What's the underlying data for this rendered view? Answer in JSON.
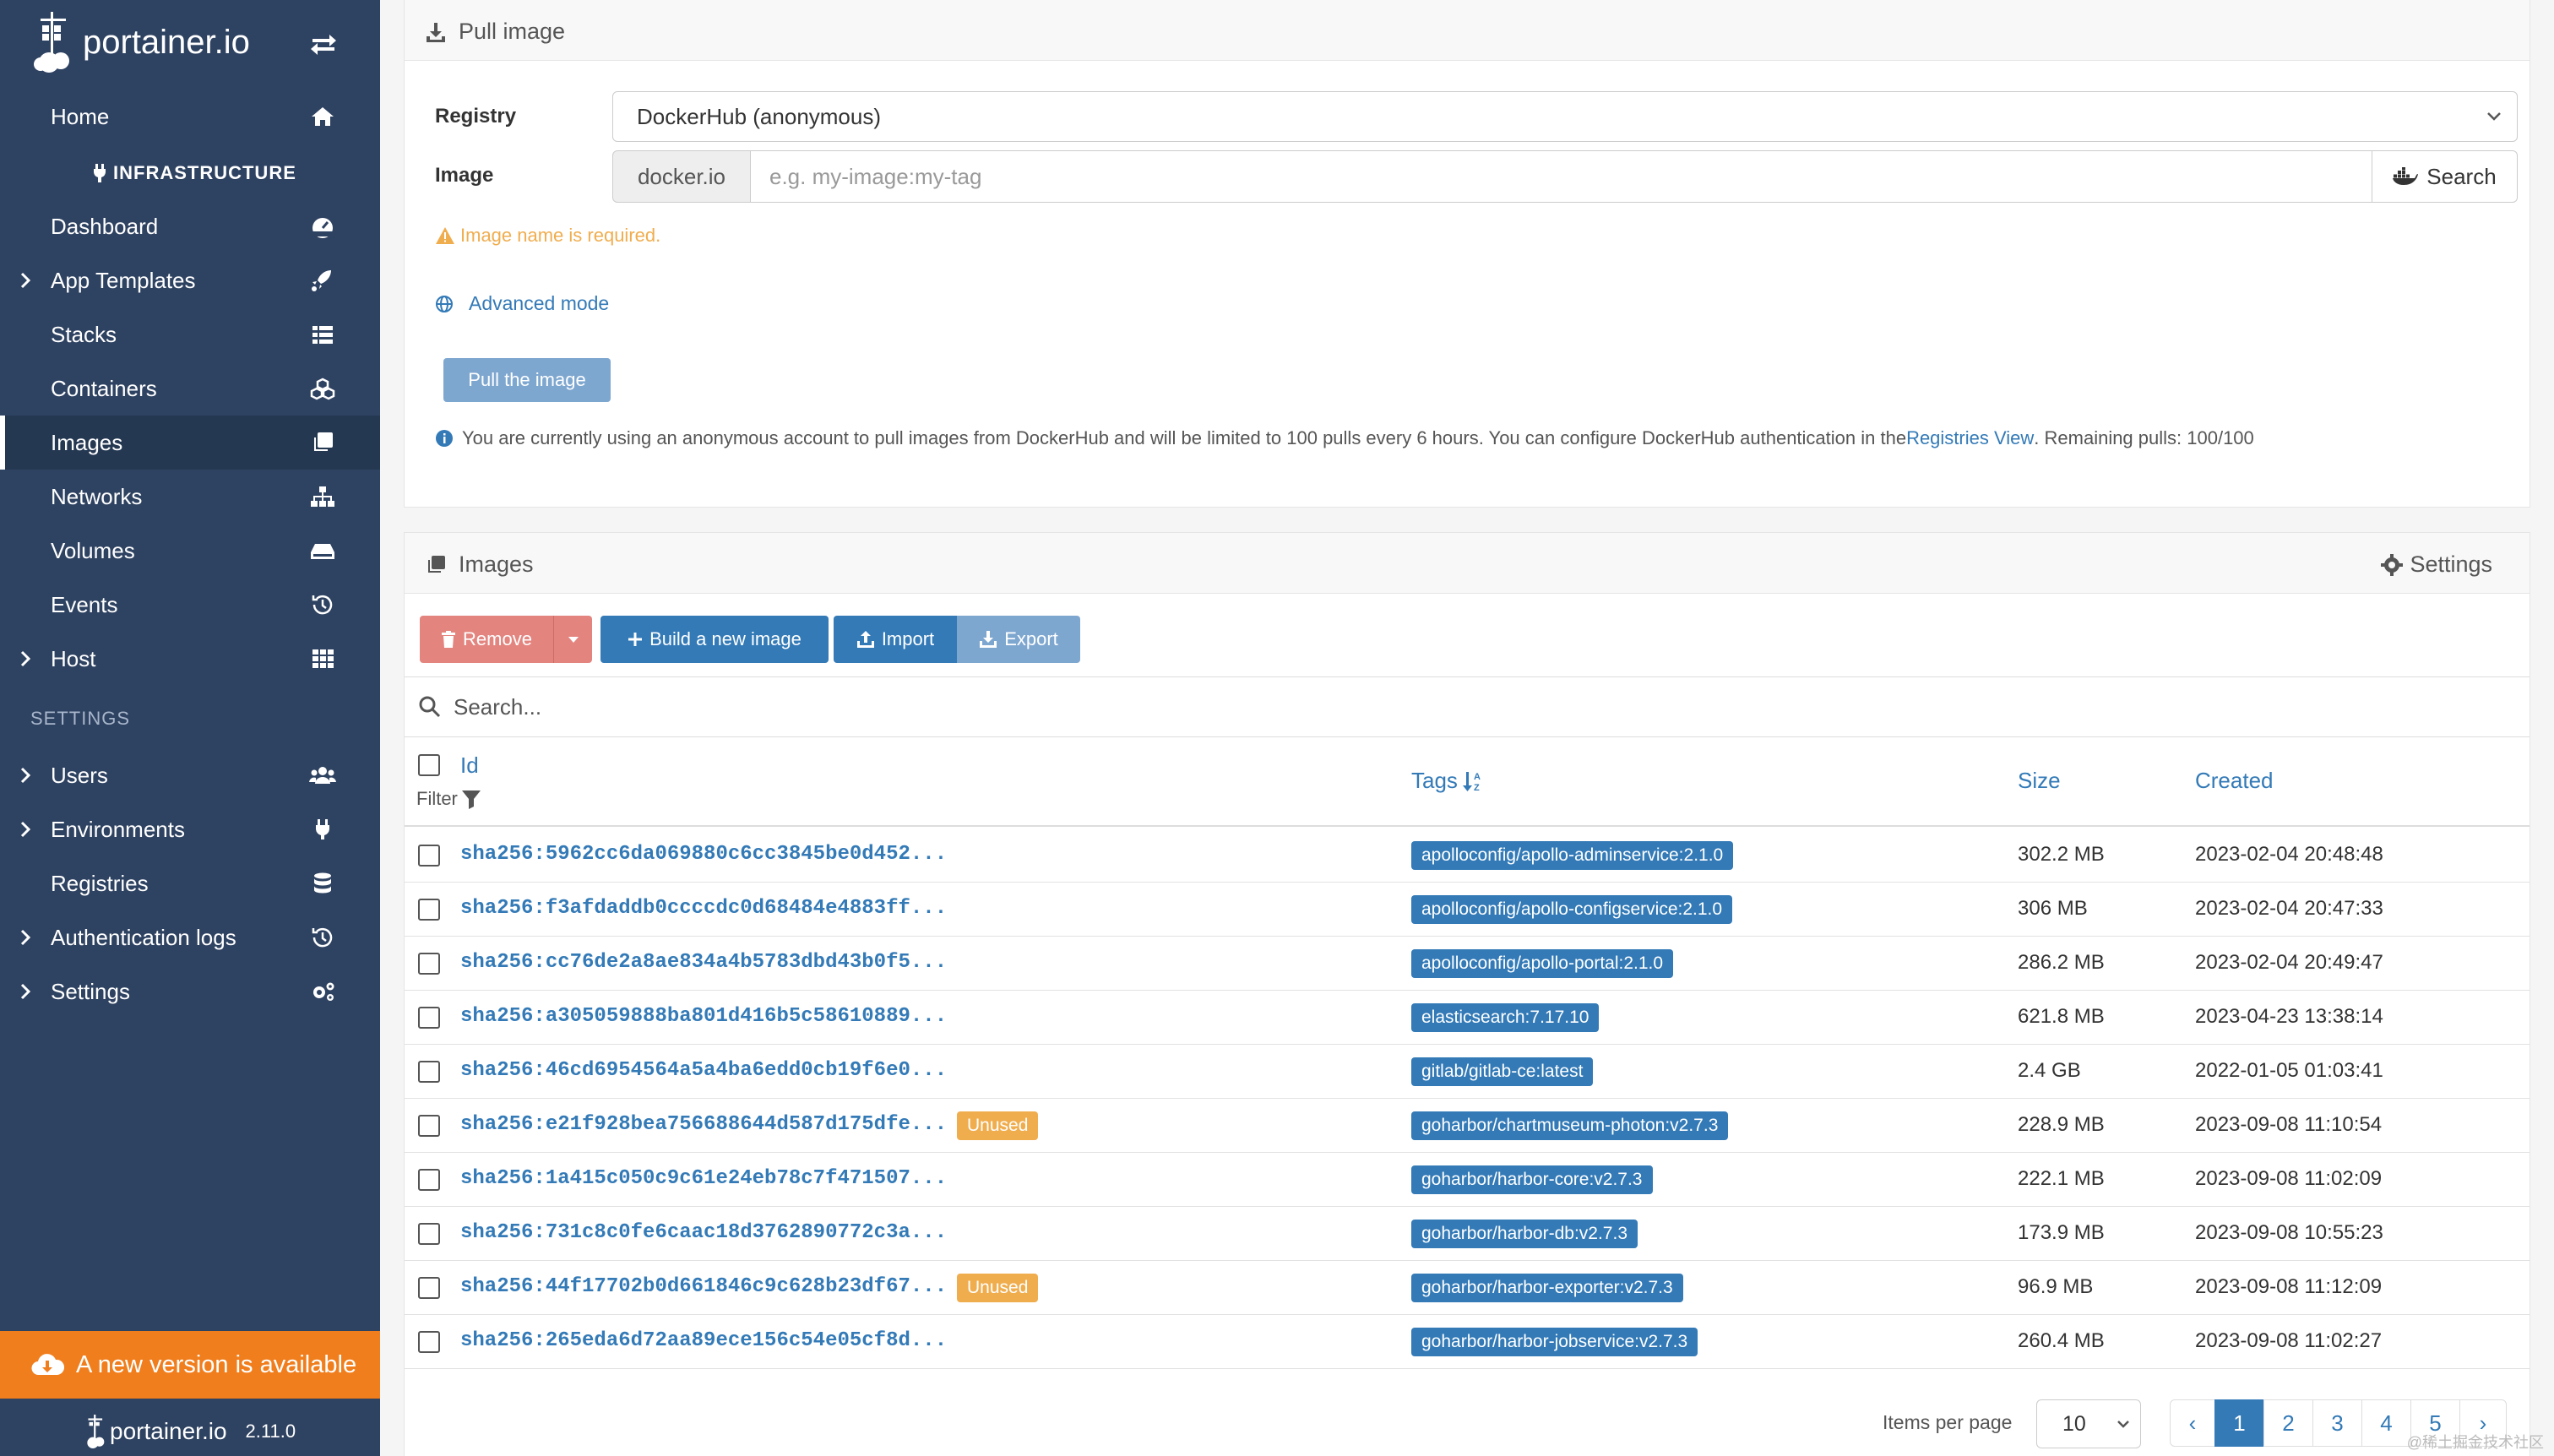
{
  "sidebar": {
    "brand": "portainer.io",
    "nav": [
      {
        "label": "Home",
        "icon": "home-icon"
      },
      {
        "label": "INFRASTRUCTURE"
      },
      {
        "label": "Dashboard",
        "icon": "dashboard-icon"
      },
      {
        "label": "App Templates",
        "icon": "rocket-icon"
      },
      {
        "label": "Stacks",
        "icon": "list-icon"
      },
      {
        "label": "Containers",
        "icon": "cubes-icon"
      },
      {
        "label": "Images",
        "icon": "clone-icon"
      },
      {
        "label": "Networks",
        "icon": "sitemap-icon"
      },
      {
        "label": "Volumes",
        "icon": "hdd-icon"
      },
      {
        "label": "Events",
        "icon": "history-icon"
      },
      {
        "label": "Host",
        "icon": "th-icon"
      }
    ],
    "settings_heading": "SETTINGS",
    "settings_nav": [
      {
        "label": "Users",
        "icon": "users-icon"
      },
      {
        "label": "Environments",
        "icon": "plug-icon"
      },
      {
        "label": "Registries",
        "icon": "database-icon"
      },
      {
        "label": "Authentication logs",
        "icon": "history-icon"
      },
      {
        "label": "Settings",
        "icon": "cogs-icon"
      }
    ],
    "update_banner": "A new version is available",
    "footer_brand": "portainer.io",
    "version": "2.11.0"
  },
  "pull": {
    "title": "Pull image",
    "registry_label": "Registry",
    "registry_value": "DockerHub (anonymous)",
    "image_label": "Image",
    "image_prefix": "docker.io",
    "image_placeholder": "e.g. my-image:my-tag",
    "search_label": "Search",
    "warning": "Image name is required.",
    "advanced_mode": "Advanced mode",
    "pull_button": "Pull the image",
    "info_before": "You are currently using an anonymous account to pull images from DockerHub and will be limited to 100 pulls every 6 hours. You can configure DockerHub authentication in the ",
    "info_link": "Registries View",
    "info_after": ". Remaining pulls: 100/100"
  },
  "images": {
    "title": "Images",
    "settings_label": "Settings",
    "remove_label": "Remove",
    "build_label": "Build a new image",
    "import_label": "Import",
    "export_label": "Export",
    "search_placeholder": "Search...",
    "columns": {
      "id": "Id",
      "filter": "Filter",
      "tags": "Tags",
      "size": "Size",
      "created": "Created"
    },
    "rows": [
      {
        "id": "sha256:5962cc6da069880c6cc3845be0d452...",
        "unused": "",
        "tag": "apolloconfig/apollo-adminservice:2.1.0",
        "size": "302.2 MB",
        "created": "2023-02-04 20:48:48"
      },
      {
        "id": "sha256:f3afdaddb0ccccdc0d68484e4883ff...",
        "unused": "",
        "tag": "apolloconfig/apollo-configservice:2.1.0",
        "size": "306 MB",
        "created": "2023-02-04 20:47:33"
      },
      {
        "id": "sha256:cc76de2a8ae834a4b5783dbd43b0f5...",
        "unused": "",
        "tag": "apolloconfig/apollo-portal:2.1.0",
        "size": "286.2 MB",
        "created": "2023-02-04 20:49:47"
      },
      {
        "id": "sha256:a305059888ba801d416b5c58610889...",
        "unused": "",
        "tag": "elasticsearch:7.17.10",
        "size": "621.8 MB",
        "created": "2023-04-23 13:38:14"
      },
      {
        "id": "sha256:46cd6954564a5a4ba6edd0cb19f6e0...",
        "unused": "",
        "tag": "gitlab/gitlab-ce:latest",
        "size": "2.4 GB",
        "created": "2022-01-05 01:03:41"
      },
      {
        "id": "sha256:e21f928bea756688644d587d175dfe...",
        "unused": "Unused",
        "tag": "goharbor/chartmuseum-photon:v2.7.3",
        "size": "228.9 MB",
        "created": "2023-09-08 11:10:54"
      },
      {
        "id": "sha256:1a415c050c9c61e24eb78c7f471507...",
        "unused": "",
        "tag": "goharbor/harbor-core:v2.7.3",
        "size": "222.1 MB",
        "created": "2023-09-08 11:02:09"
      },
      {
        "id": "sha256:731c8c0fe6caac18d3762890772c3a...",
        "unused": "",
        "tag": "goharbor/harbor-db:v2.7.3",
        "size": "173.9 MB",
        "created": "2023-09-08 10:55:23"
      },
      {
        "id": "sha256:44f17702b0d661846c9c628b23df67...",
        "unused": "Unused",
        "tag": "goharbor/harbor-exporter:v2.7.3",
        "size": "96.9 MB",
        "created": "2023-09-08 11:12:09"
      },
      {
        "id": "sha256:265eda6d72aa89ece156c54e05cf8d...",
        "unused": "",
        "tag": "goharbor/harbor-jobservice:v2.7.3",
        "size": "260.4 MB",
        "created": "2023-09-08 11:02:27"
      }
    ],
    "items_per_page_label": "Items per page",
    "items_per_page": "10",
    "pages": [
      "‹",
      "1",
      "2",
      "3",
      "4",
      "5",
      "›"
    ],
    "current_page": "1"
  },
  "watermark": "@稀土掘金技术社区",
  "colors": {
    "sidebar": "#2e4261",
    "primary": "#337ab7",
    "warning": "#f0ad4e",
    "danger_muted": "#e4847f",
    "banner": "#f07e1d"
  }
}
